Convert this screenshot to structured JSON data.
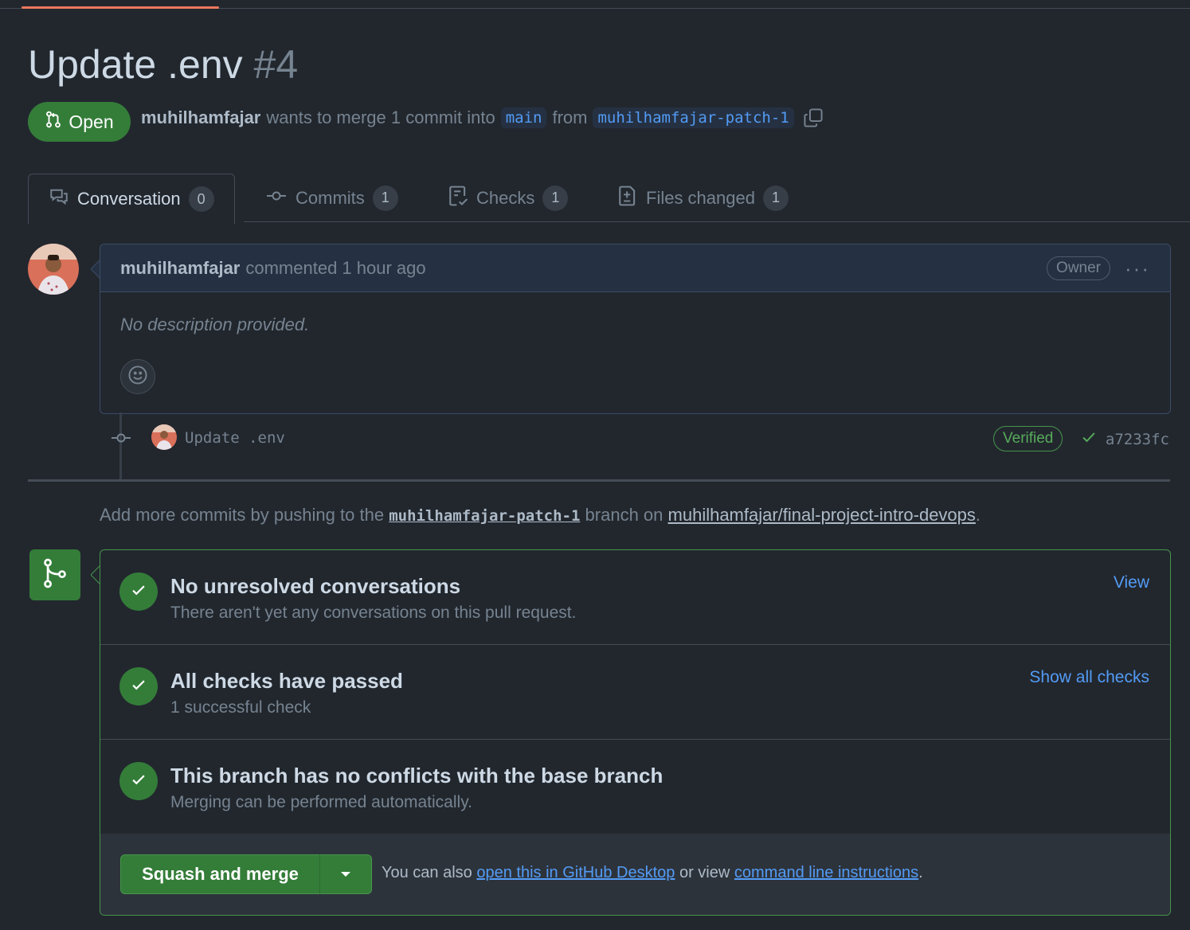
{
  "pr": {
    "title": "Update .env",
    "number": "#4",
    "state": "Open",
    "author": "muhilhamfajar",
    "merge_text": "wants to merge 1 commit into",
    "base_branch": "main",
    "from_text": "from",
    "head_branch": "muhilhamfajar-patch-1"
  },
  "tabs": [
    {
      "label": "Conversation",
      "count": "0"
    },
    {
      "label": "Commits",
      "count": "1"
    },
    {
      "label": "Checks",
      "count": "1"
    },
    {
      "label": "Files changed",
      "count": "1"
    }
  ],
  "comment": {
    "author": "muhilhamfajar",
    "action": "commented 1 hour ago",
    "role": "Owner",
    "body": "No description provided."
  },
  "commit": {
    "message": "Update .env",
    "verified": "Verified",
    "sha": "a7233fc"
  },
  "add_commits": {
    "prefix": "Add more commits by pushing to the",
    "branch": "muhilhamfajar-patch-1",
    "middle": "branch on",
    "repo": "muhilhamfajar/final-project-intro-devops",
    "suffix": "."
  },
  "merge_checks": [
    {
      "title": "No unresolved conversations",
      "subtitle": "There aren't yet any conversations on this pull request.",
      "link": "View"
    },
    {
      "title": "All checks have passed",
      "subtitle": "1 successful check",
      "link": "Show all checks"
    },
    {
      "title": "This branch has no conflicts with the base branch",
      "subtitle": "Merging can be performed automatically.",
      "link": ""
    }
  ],
  "merge_action": {
    "button": "Squash and merge",
    "also_prefix": "You can also",
    "desktop_link": "open this in GitHub Desktop",
    "or_view": "or view",
    "cli_link": "command line instructions",
    "suffix": "."
  },
  "colors": {
    "background": "#22272e",
    "open_green": "#347d39",
    "link_blue": "#539bf5",
    "tab_accent": "#ec775c"
  }
}
